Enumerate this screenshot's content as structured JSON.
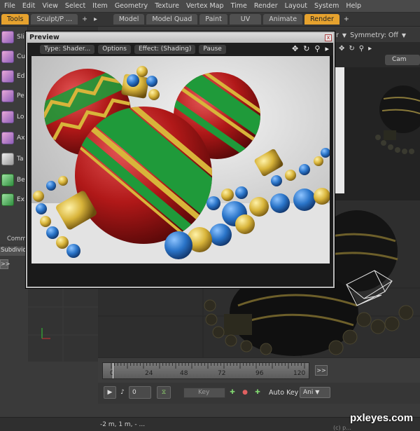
{
  "menubar": {
    "items": [
      "File",
      "Edit",
      "View",
      "Select",
      "Item",
      "Geometry",
      "Texture",
      "Vertex Map",
      "Time",
      "Render",
      "Layout",
      "System",
      "Help"
    ]
  },
  "tabs": {
    "left": [
      "Tools",
      "Sculpt/P ..."
    ],
    "plus": "+",
    "more": "▸",
    "main": [
      "Model",
      "Model Quad",
      "Paint",
      "UV",
      "Animate",
      "Render"
    ],
    "active_left": "Tools",
    "active_main": "Render",
    "add": "+"
  },
  "lefttools": {
    "items": [
      "Sli",
      "Cu",
      "Ed",
      "Pe",
      "Lo",
      "Ax",
      "Ta",
      "Be",
      "Ex"
    ],
    "commands_label": "Comm",
    "subdivide_label": "Subdivide",
    "expand": ">>"
  },
  "symmetry": {
    "left_fragment": "r",
    "label": "Symmetry: Off"
  },
  "camera": {
    "label": "Cam"
  },
  "preview": {
    "title": "Preview",
    "close": "x",
    "buttons": [
      "Type: Shader...",
      "Options",
      "Effect: (Shading)",
      "Pause"
    ]
  },
  "timeline": {
    "ticks": [
      "0",
      "24",
      "48",
      "72",
      "96",
      "120"
    ],
    "end_button": ">>"
  },
  "transport": {
    "frame": "0",
    "key_placeholder": "Key",
    "autokey_label": "Auto Key",
    "autokey_value": "Ani"
  },
  "status": {
    "text": "-2 m, 1 m, - ..."
  },
  "watermark": {
    "brand": "pxleyes.com",
    "fragment": "(c) p..."
  },
  "colors": {
    "accent": "#e6a22e",
    "ornament_red": "#b01818",
    "ornament_green": "#1f9a3a",
    "gold": "#d8b43a",
    "bead_blue": "#2a74c8"
  }
}
